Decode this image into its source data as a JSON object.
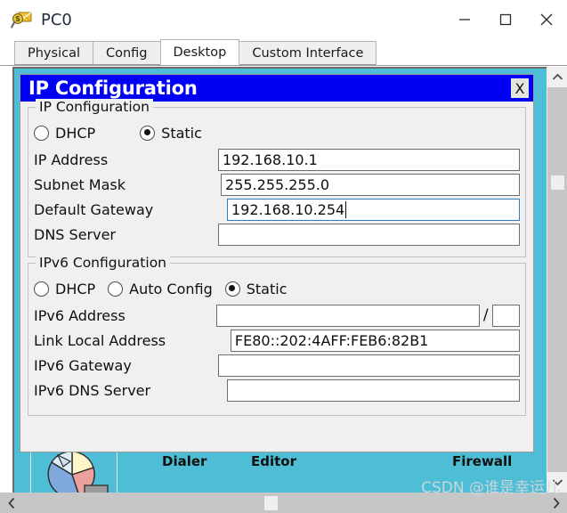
{
  "window": {
    "title": "PC0",
    "icon": "packet-tracer-inspect-icon",
    "buttons": {
      "minimize": "minimize-icon",
      "maximize": "maximize-icon",
      "close": "close-icon"
    }
  },
  "tabs": [
    {
      "label": "Physical",
      "active": false
    },
    {
      "label": "Config",
      "active": false
    },
    {
      "label": "Desktop",
      "active": true
    },
    {
      "label": "Custom Interface",
      "active": false
    }
  ],
  "dialog": {
    "title": "IP Configuration",
    "close_label": "X",
    "ipv4": {
      "legend": "IP Configuration",
      "radios": [
        {
          "label": "DHCP",
          "checked": false
        },
        {
          "label": "Static",
          "checked": true
        }
      ],
      "fields": [
        {
          "label": "IP Address",
          "value": "192.168.10.1",
          "focused": false
        },
        {
          "label": "Subnet Mask",
          "value": "255.255.255.0",
          "focused": false
        },
        {
          "label": "Default Gateway",
          "value": "192.168.10.254",
          "focused": true
        },
        {
          "label": "DNS Server",
          "value": "",
          "focused": false
        }
      ]
    },
    "ipv6": {
      "legend": "IPv6 Configuration",
      "radios": [
        {
          "label": "DHCP",
          "checked": false
        },
        {
          "label": "Auto Config",
          "checked": false
        },
        {
          "label": "Static",
          "checked": true
        }
      ],
      "address": {
        "label": "IPv6 Address",
        "value": "",
        "prefix_separator": "/",
        "prefix_value": ""
      },
      "fields": [
        {
          "label": "Link Local Address",
          "value": "FE80::202:4AFF:FEB6:82B1"
        },
        {
          "label": "IPv6 Gateway",
          "value": ""
        },
        {
          "label": "IPv6 DNS Server",
          "value": ""
        }
      ]
    }
  },
  "desktop_background": {
    "icon_labels": [
      "Dialer",
      "Editor",
      "Firewall"
    ],
    "pie_icon": "traffic-generator-pie-icon",
    "color": "#4ebdd6"
  },
  "scrollbars": {
    "vertical": {
      "up": "chevron-up-icon",
      "down": "chevron-down-icon"
    },
    "horizontal": {
      "left": "chevron-left-icon",
      "right": "chevron-right-icon"
    }
  },
  "watermark": "CSDN @谁是幸运儿"
}
